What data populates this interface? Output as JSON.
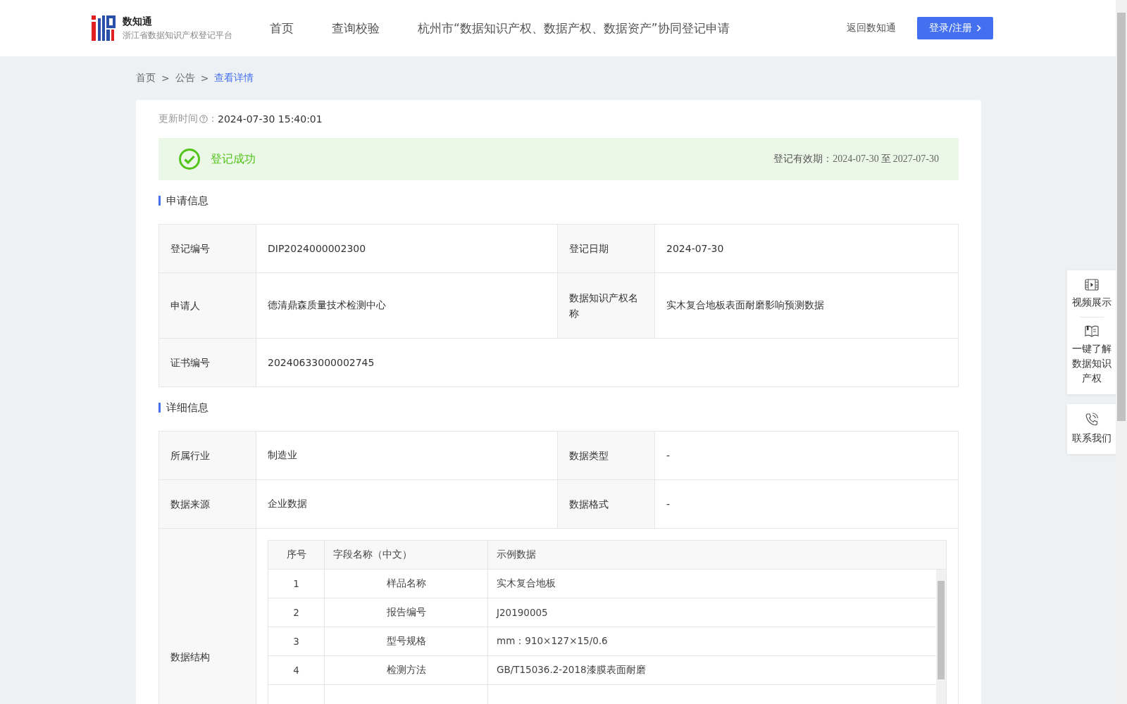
{
  "header": {
    "logo_title": "数知通",
    "logo_subtitle": "浙江省数据知识产权登记平台",
    "nav": [
      {
        "label": "首页",
        "selected": false
      },
      {
        "label": "查询校验",
        "selected": false
      },
      {
        "label": "杭州市“数据知识产权、数据产权、数据资产”协同登记申请",
        "selected": false
      }
    ],
    "back_link": "返回数知通",
    "login_button": "登录/注册"
  },
  "breadcrumb": [
    {
      "label": "首页",
      "current": false
    },
    {
      "label": "公告",
      "current": false
    },
    {
      "label": "查看详情",
      "current": true
    }
  ],
  "breadcrumb_separator": ">",
  "update": {
    "label": "更新时间",
    "colon": "：",
    "value": "2024-07-30 15:40:01"
  },
  "status": {
    "text": "登记成功",
    "validity_label": "登记有效期：",
    "validity_from": "2024-07-30",
    "validity_to_word": "至",
    "validity_to": "2027-07-30"
  },
  "sections": [
    {
      "title": "申请信息",
      "rows": [
        [
          {
            "label": "登记编号",
            "value": "DIP2024000002300"
          },
          {
            "label": "登记日期",
            "value": "2024-07-30"
          }
        ],
        [
          {
            "label": "申请人",
            "value": "德清鼎森质量技术检测中心"
          },
          {
            "label": "数据知识产权名称",
            "value": "实木复合地板表面耐磨影响预测数据"
          }
        ],
        [
          {
            "label": "证书编号",
            "value": "20240633000002745"
          }
        ]
      ]
    },
    {
      "title": "详细信息",
      "rows": [
        [
          {
            "label": "所属行业",
            "value": "制造业"
          },
          {
            "label": "数据类型",
            "value": "-"
          }
        ],
        [
          {
            "label": "数据来源",
            "value": "企业数据"
          },
          {
            "label": "数据格式",
            "value": "-"
          }
        ]
      ],
      "structure": {
        "label": "数据结构",
        "columns": [
          "序号",
          "字段名称（中文）",
          "示例数据"
        ],
        "rows": [
          [
            "1",
            "样品名称",
            "实木复合地板"
          ],
          [
            "2",
            "报告编号",
            "J20190005"
          ],
          [
            "3",
            "型号规格",
            "mm：910×127×15/0.6"
          ],
          [
            "4",
            "检测方法",
            "GB/T15036.2-2018漆膜表面耐磨"
          ]
        ]
      }
    }
  ],
  "float_bar": [
    {
      "kind": "video",
      "label": "视频展示"
    },
    {
      "kind": "book",
      "label": "一键了解数据知识产权"
    },
    {
      "kind": "phone",
      "label": "联系我们"
    }
  ]
}
